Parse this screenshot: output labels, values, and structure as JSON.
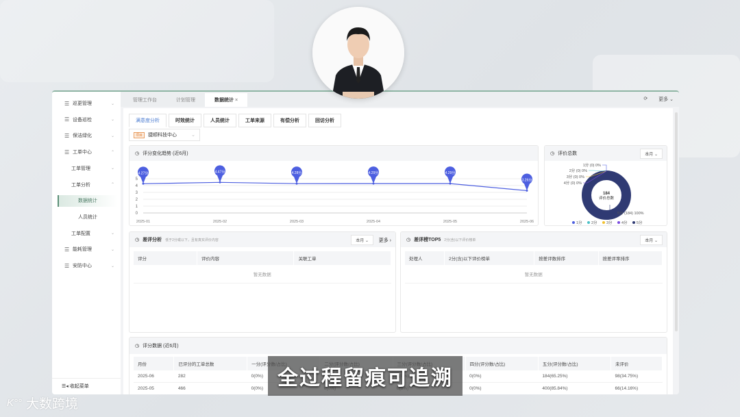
{
  "sidebar": {
    "items": [
      {
        "label": "巡更管理",
        "level": 0,
        "chev": "⌄"
      },
      {
        "label": "设备巡检",
        "level": 0,
        "chev": "⌄"
      },
      {
        "label": "保洁绿化",
        "level": 0,
        "chev": "⌄"
      },
      {
        "label": "工单中心",
        "level": 0,
        "chev": "⌃"
      },
      {
        "label": "工单管理",
        "level": 1,
        "chev": "⌄"
      },
      {
        "label": "工单分析",
        "level": 1,
        "chev": "⌃"
      },
      {
        "label": "数据统计",
        "level": 2,
        "active": true
      },
      {
        "label": "人员统计",
        "level": 2
      },
      {
        "label": "工单配置",
        "level": 1,
        "chev": "⌄"
      },
      {
        "label": "能耗管理",
        "level": 0,
        "chev": "⌄"
      },
      {
        "label": "安防中心",
        "level": 0,
        "chev": "⌄"
      }
    ],
    "collapse": "收起菜单"
  },
  "tabs": [
    {
      "label": "管理工作台"
    },
    {
      "label": "计划管理"
    },
    {
      "label": "数据统计",
      "active": true,
      "close": "×"
    }
  ],
  "toolbar": {
    "more": "更多"
  },
  "subtabs": [
    "满意度分析",
    "时效统计",
    "人员统计",
    "工单来源",
    "有偿分析",
    "回访分析"
  ],
  "project": {
    "badge": "项目",
    "name": "捷顺科技中心"
  },
  "trend": {
    "title": "评分变化趋势 (近6月)"
  },
  "chart_data": [
    {
      "type": "line",
      "title": "评分变化趋势 (近6月)",
      "categories": [
        "2025-01",
        "2025-02",
        "2025-03",
        "2025-04",
        "2025-05",
        "2025-06"
      ],
      "values": [
        4.27,
        4.47,
        4.28,
        4.29,
        4.29,
        3.26
      ],
      "labels": [
        "4.27分",
        "4.47分",
        "4.28分",
        "4.29分",
        "4.29分",
        "3.26分"
      ],
      "ylim": [
        0,
        5
      ],
      "yticks": [
        "0",
        "1",
        "2",
        "3",
        "4",
        "5"
      ],
      "color": "#4d5fe0"
    },
    {
      "type": "pie",
      "title": "评价总数",
      "center_value": "184",
      "center_label": "评价总数",
      "categories": [
        "1分",
        "2分",
        "3分",
        "4分",
        "5分"
      ],
      "values": [
        0,
        0,
        0,
        0,
        184
      ],
      "labels": [
        "1分 (0) 0%",
        "2分 (0) 0%",
        "3分 (0) 0%",
        "4分 (0) 0%",
        "5分 (184) 100%"
      ],
      "colors": [
        "#4d5fe0",
        "#4cc1c7",
        "#f2c230",
        "#7b4de0",
        "#2f3a73"
      ]
    }
  ],
  "total": {
    "title": "评价总数",
    "period": "本月"
  },
  "bad": {
    "title": "差评分析",
    "desc": "低于2分或以下，且有真实评价内容",
    "period": "本月",
    "more": "更多 ›",
    "cols": [
      "评分",
      "评价内容",
      "关联工单"
    ],
    "empty": "暂无数据"
  },
  "top5": {
    "title": "差评榜TOP5",
    "desc": "2分(含)以下评价榜单",
    "period": "本月",
    "cols": [
      "处理人",
      "2分(含)以下评价榜单",
      "按差评数排序",
      "按差评率排序"
    ],
    "empty": "暂无数据"
  },
  "score": {
    "title": "评分数据 (近6月)",
    "cols": [
      "月份",
      "已评分的工单总数",
      "一分(评分数/占比)",
      "二分(评分数/占比)",
      "三分(评分数/占比)",
      "四分(评分数/占比)",
      "五分(评分数/占比)",
      "未评价"
    ],
    "rows": [
      [
        "2025-06",
        "282",
        "0(0%)",
        "0(0%)",
        "0(0%)",
        "0(0%)",
        "184(65.25%)",
        "98(34.75%)"
      ],
      [
        "2025-05",
        "466",
        "0(0%)",
        "0(0%)",
        "0(0%)",
        "0(0%)",
        "400(85.84%)",
        "66(14.16%)"
      ]
    ]
  },
  "caption": "全过程留痕可追溯",
  "logo": {
    "mark": "K100",
    "text": "大数跨境"
  }
}
